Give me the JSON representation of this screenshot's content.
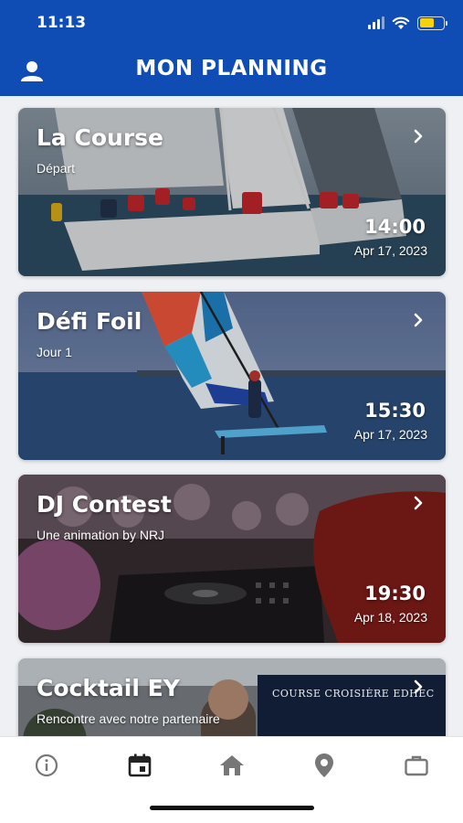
{
  "status_bar": {
    "time": "11:13"
  },
  "header": {
    "title": "MON PLANNING",
    "left_icon": "user-icon"
  },
  "events": [
    {
      "title": "La Course",
      "subtitle": "Départ",
      "time": "14:00",
      "date": "Apr 17, 2023"
    },
    {
      "title": "Défi Foil",
      "subtitle": "Jour 1",
      "time": "15:30",
      "date": "Apr 17, 2023"
    },
    {
      "title": "DJ Contest",
      "subtitle": "Une animation by NRJ",
      "time": "19:30",
      "date": "Apr 18, 2023"
    },
    {
      "title": "Cocktail EY",
      "subtitle": "Rencontre avec notre partenaire",
      "banner": "COURSE CROISIÈRE EDHEC"
    }
  ],
  "tabbar": {
    "tabs": [
      "info-icon",
      "calendar-icon",
      "home-icon",
      "location-pin-icon",
      "briefcase-icon"
    ],
    "active": "calendar-icon"
  },
  "colors": {
    "header_bg": "#0f4cb3",
    "active_tab": "#222222",
    "inactive_tab": "#777777",
    "battery": "#f5d20b"
  }
}
